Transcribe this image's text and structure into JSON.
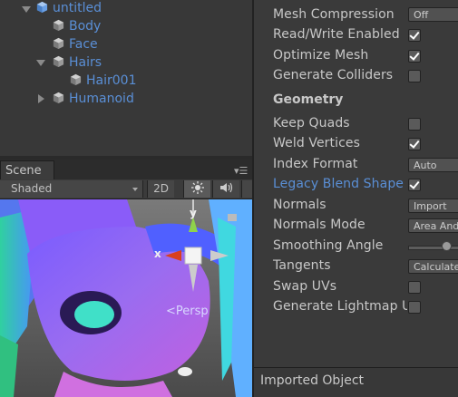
{
  "hierarchy": {
    "root": "untitled",
    "items": [
      "Body",
      "Face",
      "Hairs",
      "Hair001",
      "Humanoid"
    ]
  },
  "scene": {
    "tab_label": "Scene",
    "draw_mode": "Shaded",
    "mode_2d": "2D",
    "gizmo_y": "y",
    "gizmo_x": "x",
    "projection": "Persp"
  },
  "inspector": {
    "mesh_compression": {
      "label": "Mesh Compression",
      "value": "Off"
    },
    "read_write": {
      "label": "Read/Write Enabled",
      "checked": true
    },
    "optimize_mesh": {
      "label": "Optimize Mesh",
      "checked": true
    },
    "generate_colliders": {
      "label": "Generate Colliders",
      "checked": false
    },
    "geometry_header": "Geometry",
    "keep_quads": {
      "label": "Keep Quads",
      "checked": false
    },
    "weld_vertices": {
      "label": "Weld Vertices",
      "checked": true
    },
    "index_format": {
      "label": "Index Format",
      "value": "Auto"
    },
    "legacy_blend": {
      "label": "Legacy Blend Shape",
      "checked": true
    },
    "normals": {
      "label": "Normals",
      "value": "Import"
    },
    "normals_mode": {
      "label": "Normals Mode",
      "value": "Area And"
    },
    "smoothing_angle": {
      "label": "Smoothing Angle"
    },
    "tangents": {
      "label": "Tangents",
      "value": "Calculate"
    },
    "swap_uvs": {
      "label": "Swap UVs",
      "checked": false
    },
    "lightmap": {
      "label": "Generate Lightmap U",
      "checked": false
    }
  },
  "footer": {
    "imported_object": "Imported Object"
  },
  "colors": {
    "link_blue": "#5a8fd6",
    "panel": "#383838"
  }
}
